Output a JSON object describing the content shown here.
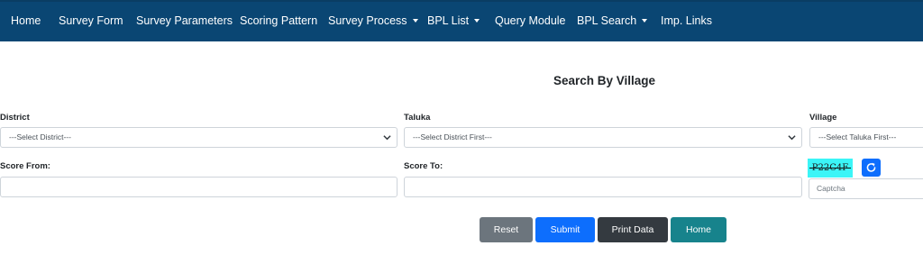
{
  "nav": {
    "items": [
      {
        "label": "Home",
        "dropdown": false
      },
      {
        "label": "Survey Form",
        "dropdown": false
      },
      {
        "label": "Survey Parameters",
        "dropdown": false
      },
      {
        "label": "Scoring Pattern",
        "dropdown": false
      },
      {
        "label": "Survey Process",
        "dropdown": true
      },
      {
        "label": "BPL List",
        "dropdown": true
      },
      {
        "label": "Query Module",
        "dropdown": false
      },
      {
        "label": "BPL Search",
        "dropdown": true
      },
      {
        "label": "Imp. Links",
        "dropdown": false
      }
    ]
  },
  "page": {
    "title": "Search By Village"
  },
  "form": {
    "district": {
      "label": "District",
      "value": "---Select District---"
    },
    "taluka": {
      "label": "Taluka",
      "value": "---Select District First---"
    },
    "village": {
      "label": "Village",
      "value": "---Select Taluka First---"
    },
    "score_from": {
      "label": "Score From:",
      "value": ""
    },
    "score_to": {
      "label": "Score To:",
      "value": ""
    },
    "captcha": {
      "image_text": "P22C4F",
      "placeholder": "Captcha",
      "value": ""
    }
  },
  "buttons": {
    "reset": "Reset",
    "submit": "Submit",
    "print": "Print Data",
    "home": "Home"
  },
  "colors": {
    "navbar": "#0a4673",
    "reset": "#6c757d",
    "submit": "#0d6efd",
    "print": "#343a40",
    "home": "#17838c",
    "captcha_bg": "#3bf5f7"
  },
  "icons": {
    "refresh": "refresh-icon",
    "select_arrow": "chevron-down-icon"
  }
}
